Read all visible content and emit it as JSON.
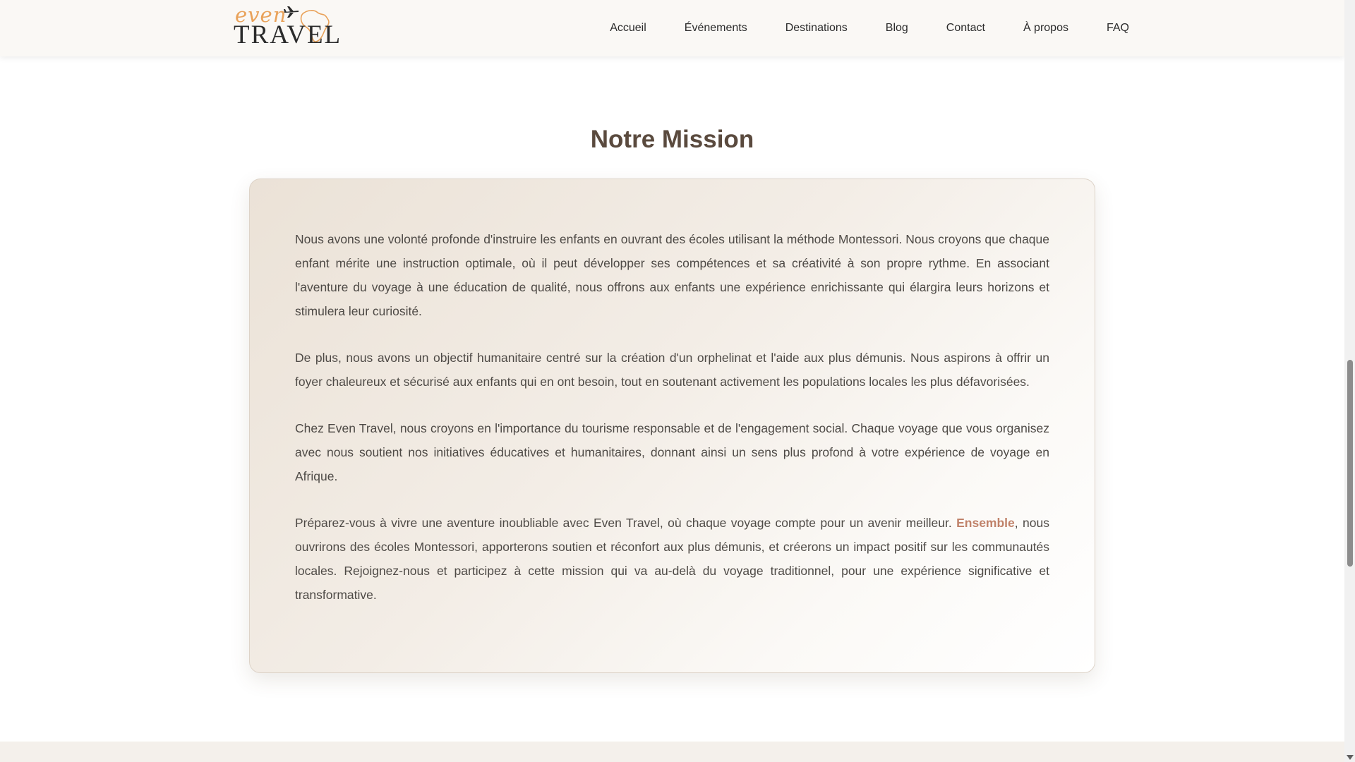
{
  "brand": {
    "logo_word_top": "even",
    "logo_word_bottom": "TRAVEL",
    "logo_icons": [
      "plane-icon",
      "africa-outline-icon"
    ],
    "colors": {
      "accent": "#e9a25a",
      "title": "#5a4a3e",
      "highlight": "#c0826a",
      "text": "#4e4a46"
    }
  },
  "nav": {
    "items": [
      {
        "label": "Accueil"
      },
      {
        "label": "Événements"
      },
      {
        "label": "Destinations"
      },
      {
        "label": "Blog"
      },
      {
        "label": "Contact"
      },
      {
        "label": "À propos"
      },
      {
        "label": "FAQ"
      }
    ]
  },
  "mission": {
    "title": "Notre Mission",
    "paragraphs": [
      "Nous avons une volonté profonde d'instruire les enfants en ouvrant des écoles utilisant la méthode Montessori. Nous croyons que chaque enfant mérite une instruction optimale, où il peut développer ses compétences et sa créativité à son propre rythme. En associant l'aventure du voyage à une éducation de qualité, nous offrons aux enfants une expérience enrichissante qui élargira leurs horizons et stimulera leur curiosité.",
      "De plus, nous avons un objectif humanitaire centré sur la création d'un orphelinat et l'aide aux plus démunis. Nous aspirons à offrir un foyer chaleureux et sécurisé aux enfants qui en ont besoin, tout en soutenant activement les populations locales les plus défavorisées.",
      "Chez Even Travel, nous croyons en l'importance du tourisme responsable et de l'engagement social. Chaque voyage que vous organisez avec nous soutient nos initiatives éducatives et humanitaires, donnant ainsi un sens plus profond à votre expérience de voyage en Afrique."
    ],
    "last_paragraph": {
      "before": "Préparez-vous à vivre une aventure inoubliable avec Even Travel, où chaque voyage compte pour un avenir meilleur. ",
      "highlight": "Ensemble",
      "after": ", nous ouvrirons des écoles Montessori, apporterons soutien et réconfort aux plus démunis, et créerons un impact positif sur les communautés locales. Rejoignez-nous et participez à cette mission qui va au-delà du voyage traditionnel, pour une expérience significative et transformative."
    }
  }
}
